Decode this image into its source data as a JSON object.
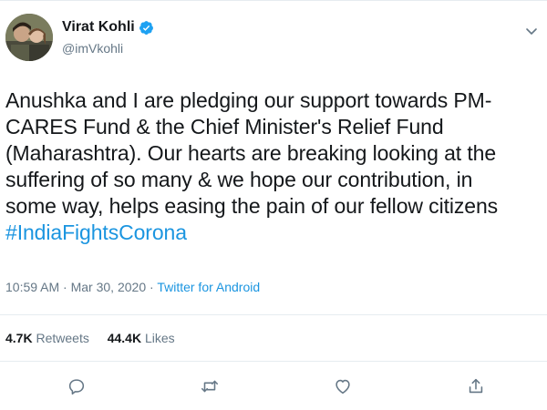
{
  "user": {
    "display_name": "Virat Kohli",
    "handle": "@imVkohli",
    "verified": true
  },
  "tweet": {
    "lines": [
      "Anushka and I are pledging our support towards PM-",
      "CARES Fund & the Chief Minister's Relief Fund",
      "(Maharashtra). Our hearts are breaking looking at the",
      "suffering of so many & we hope our contribution, in",
      "some way, helps easing the pain of our fellow citizens"
    ],
    "hashtag": "#IndiaFightsCorona"
  },
  "meta": {
    "time": "10:59 AM",
    "date": "Mar 30, 2020",
    "separator": "·",
    "source": "Twitter for Android"
  },
  "stats": {
    "retweets_count": "4.7K",
    "retweets_label": "Retweets",
    "likes_count": "44.4K",
    "likes_label": "Likes"
  },
  "icons": {
    "verified": "verified-badge-icon",
    "caret": "chevron-down-icon",
    "reply": "reply-icon",
    "retweet": "retweet-icon",
    "like": "heart-icon",
    "share": "share-icon"
  },
  "colors": {
    "accent": "#1b95e0",
    "text": "#14171a",
    "secondary": "#657786",
    "border": "#e6ecf0"
  }
}
